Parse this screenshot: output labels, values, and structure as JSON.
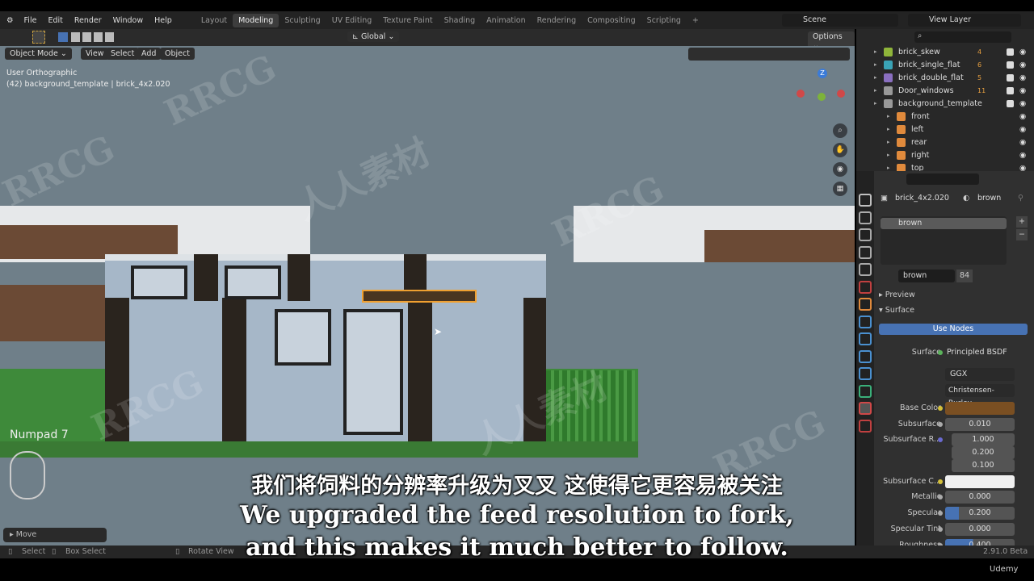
{
  "menu": [
    "File",
    "Edit",
    "Render",
    "Window",
    "Help"
  ],
  "workspaces": [
    "Layout",
    "Modeling",
    "Sculpting",
    "UV Editing",
    "Texture Paint",
    "Shading",
    "Animation",
    "Rendering",
    "Compositing",
    "Scripting"
  ],
  "active_workspace": "Modeling",
  "scene": "Scene",
  "view_layer": "View Layer",
  "toolheader": {
    "orientation": "Global",
    "options": "Options"
  },
  "viewport_header": {
    "mode": "Object Mode",
    "view": "View",
    "select": "Select",
    "add": "Add",
    "object": "Object"
  },
  "viewport": {
    "view_name": "User Orthographic",
    "object_info": "(42) background_template | brick_4x2.020",
    "key_hint": "Numpad 7",
    "last_op": "Move",
    "gizmo_z": "Z"
  },
  "outliner": {
    "items": [
      {
        "name": "brick_skew",
        "badge": "4",
        "indent": 0,
        "color": "#8fb53a"
      },
      {
        "name": "brick_single_flat",
        "badge": "6",
        "indent": 0,
        "color": "#3aa3b5"
      },
      {
        "name": "brick_double_flat",
        "badge": "5",
        "indent": 0,
        "color": "#8a6fc0"
      },
      {
        "name": "Door_windows",
        "badge": "11",
        "indent": 0,
        "color": "#999999"
      },
      {
        "name": "background_template",
        "badge": "",
        "indent": 0,
        "color": "#999999"
      },
      {
        "name": "front",
        "badge": "",
        "indent": 1,
        "color": "#e08a3c"
      },
      {
        "name": "left",
        "badge": "",
        "indent": 1,
        "color": "#e08a3c"
      },
      {
        "name": "rear",
        "badge": "",
        "indent": 1,
        "color": "#e08a3c"
      },
      {
        "name": "right",
        "badge": "",
        "indent": 1,
        "color": "#e08a3c"
      },
      {
        "name": "top",
        "badge": "",
        "indent": 1,
        "color": "#e08a3c"
      }
    ]
  },
  "properties": {
    "object": "brick_4x2.020",
    "material": "brown",
    "slot": "brown",
    "users": "84",
    "preview": "Preview",
    "surface_panel": "Surface",
    "use_nodes": "Use Nodes",
    "surface_label": "Surface",
    "surface_value": "Principled BSDF",
    "distribution": "GGX",
    "subsurface_method": "Christensen-Burley",
    "fields": [
      {
        "label": "Base Color",
        "value": "",
        "color": "#7a4f22",
        "dot": "#d4c03a"
      },
      {
        "label": "Subsurface",
        "value": "0.010",
        "dot": "#aaaaaa"
      },
      {
        "label": "Subsurface R...",
        "value": "1.000",
        "dot": "#6a6ad0"
      },
      {
        "label": "",
        "value": "0.200"
      },
      {
        "label": "",
        "value": "0.100"
      },
      {
        "label": "Subsurface C...",
        "value": "",
        "color": "#f0f0f0",
        "dot": "#d4c03a"
      },
      {
        "label": "Metallic",
        "value": "0.000",
        "dot": "#aaaaaa"
      },
      {
        "label": "Specular",
        "value": "0.200",
        "dot": "#aaaaaa",
        "fill": 0.2
      },
      {
        "label": "Specular Tint",
        "value": "0.000",
        "dot": "#aaaaaa"
      },
      {
        "label": "Roughness",
        "value": "0.400",
        "dot": "#aaaaaa",
        "fill": 0.4
      }
    ]
  },
  "status": {
    "select": "Select",
    "box_select": "Box Select",
    "rotate": "Rotate View",
    "version": "2.91.0 Beta"
  },
  "subtitles": {
    "zh": "我们将饲料的分辨率升级为叉叉 这使得它更容易被关注",
    "en1": "We upgraded the feed resolution to fork,",
    "en2": "and this makes it much better to follow."
  },
  "watermark": "RRCG",
  "watermark_cn": "人人素材",
  "udemy": "Udemy",
  "colors": {
    "accent": "#4772b3",
    "base_color": "#7a4f22"
  }
}
